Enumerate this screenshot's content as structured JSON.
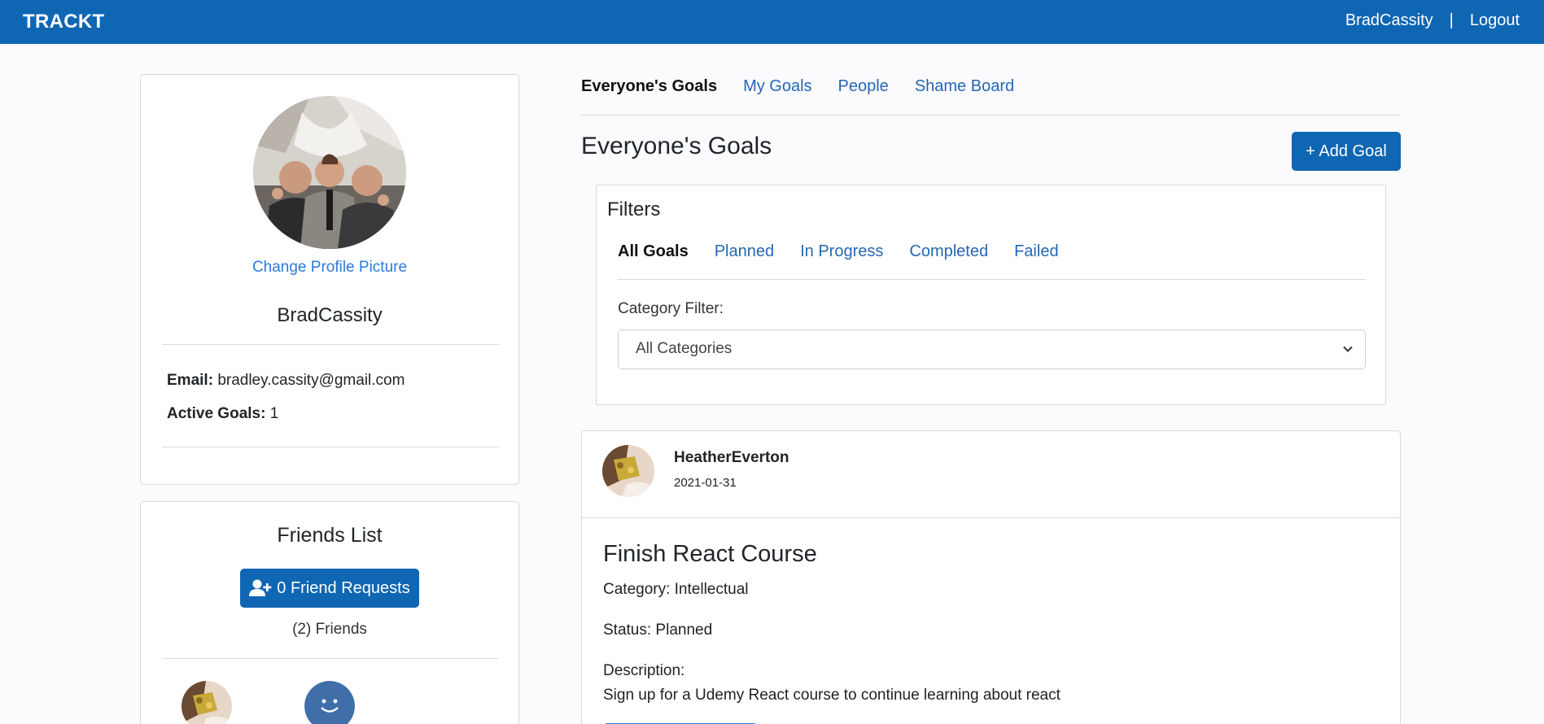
{
  "navbar": {
    "brand": "TRACKT",
    "username": "BradCassity",
    "separator": "|",
    "logout": "Logout"
  },
  "profile": {
    "change_picture": "Change Profile Picture",
    "name": "BradCassity",
    "email_label": "Email:",
    "email": "bradley.cassity@gmail.com",
    "active_goals_label": "Active Goals:",
    "active_goals": "1"
  },
  "friends": {
    "title": "Friends List",
    "requests_button": "0 Friend Requests",
    "count": "(2) Friends"
  },
  "tabs": [
    {
      "label": "Everyone's Goals",
      "active": true
    },
    {
      "label": "My Goals"
    },
    {
      "label": "People"
    },
    {
      "label": "Shame Board"
    }
  ],
  "page_title": "Everyone's Goals",
  "add_goal": "+ Add Goal",
  "filters": {
    "title": "Filters",
    "tabs": [
      {
        "label": "All Goals",
        "active": true
      },
      {
        "label": "Planned"
      },
      {
        "label": "In Progress"
      },
      {
        "label": "Completed"
      },
      {
        "label": "Failed"
      }
    ],
    "category_label": "Category Filter:",
    "category_selected": "All Categories"
  },
  "goal": {
    "user": "HeatherEverton",
    "date": "2021-01-31",
    "title": "Finish React Course",
    "category": "Category: Intellectual",
    "status": "Status: Planned",
    "description_label": "Description:",
    "description": "Sign up for a Udemy React course to continue learning about react"
  },
  "colors": {
    "navbar": "#0f66b3",
    "link": "#2567b3",
    "button": "#0f66b3"
  }
}
